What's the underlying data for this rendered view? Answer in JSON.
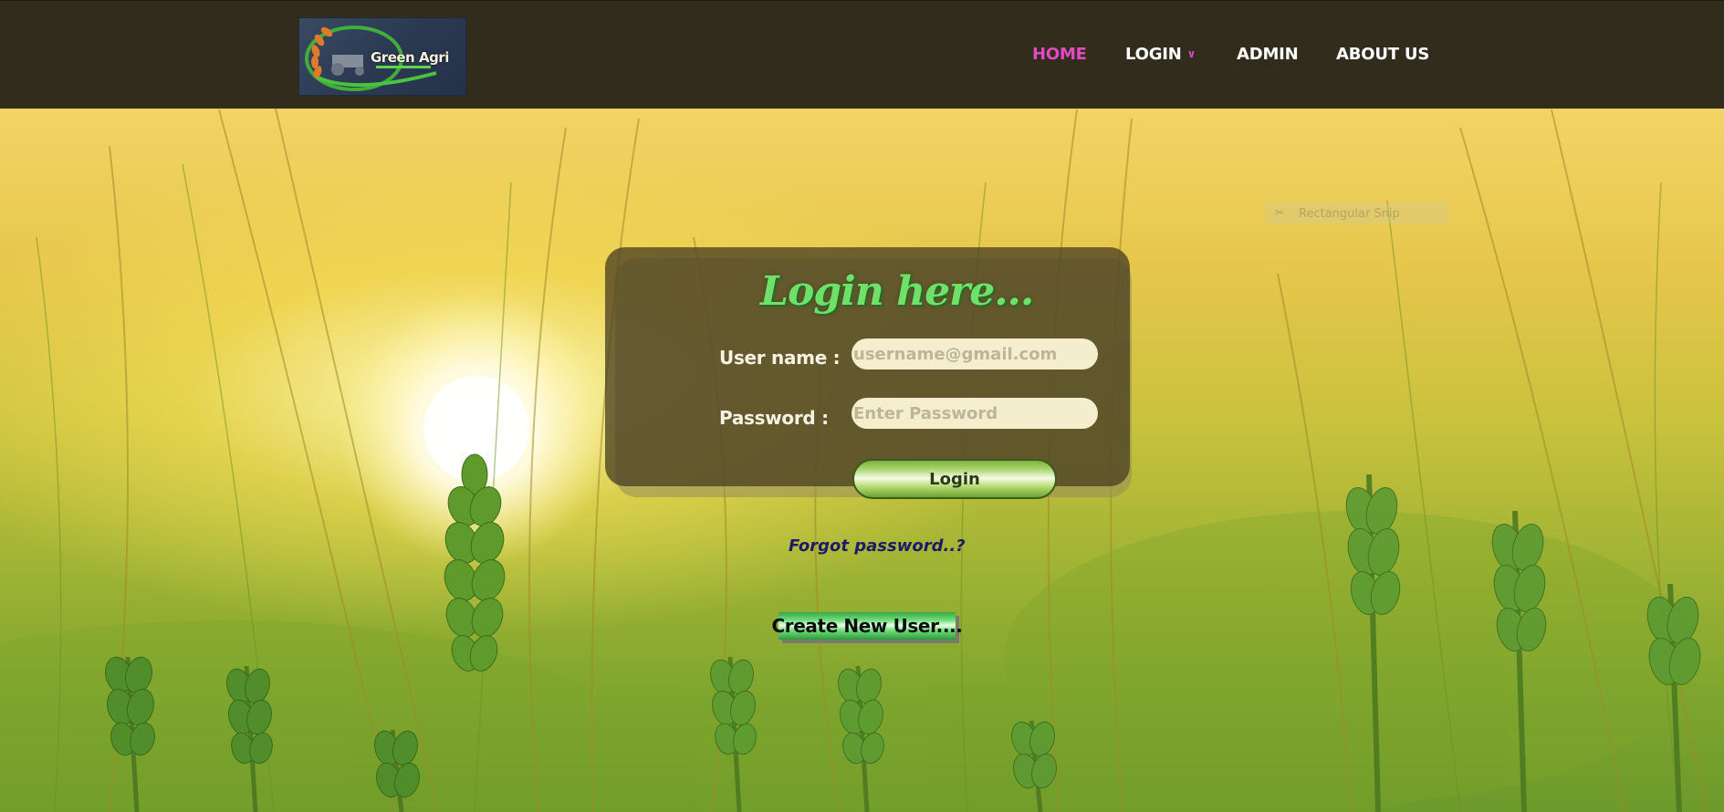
{
  "logo": {
    "text": "Green Agri"
  },
  "nav": {
    "home": "HOME",
    "login": "LOGIN",
    "admin": "ADMIN",
    "about": "ABOUT US"
  },
  "snip_tool": {
    "label": "Rectangular Snip"
  },
  "login_form": {
    "title": "Login here...",
    "username_label": "User name :",
    "username_placeholder": "username@gmail.com",
    "password_label": "Password :",
    "password_placeholder": "Enter Password",
    "submit_label": "Login"
  },
  "links": {
    "forgot_password": "Forgot password..?",
    "create_user": "Create New User...."
  },
  "colors": {
    "nav_bg": "#312c1c",
    "nav_active": "#e24ac4",
    "title_green": "#6fe06a",
    "forgot_link": "#1d1a6a"
  },
  "icons": {
    "nav_login_dropdown": "chevron-down-icon",
    "snip_tool": "scissors-icon"
  }
}
